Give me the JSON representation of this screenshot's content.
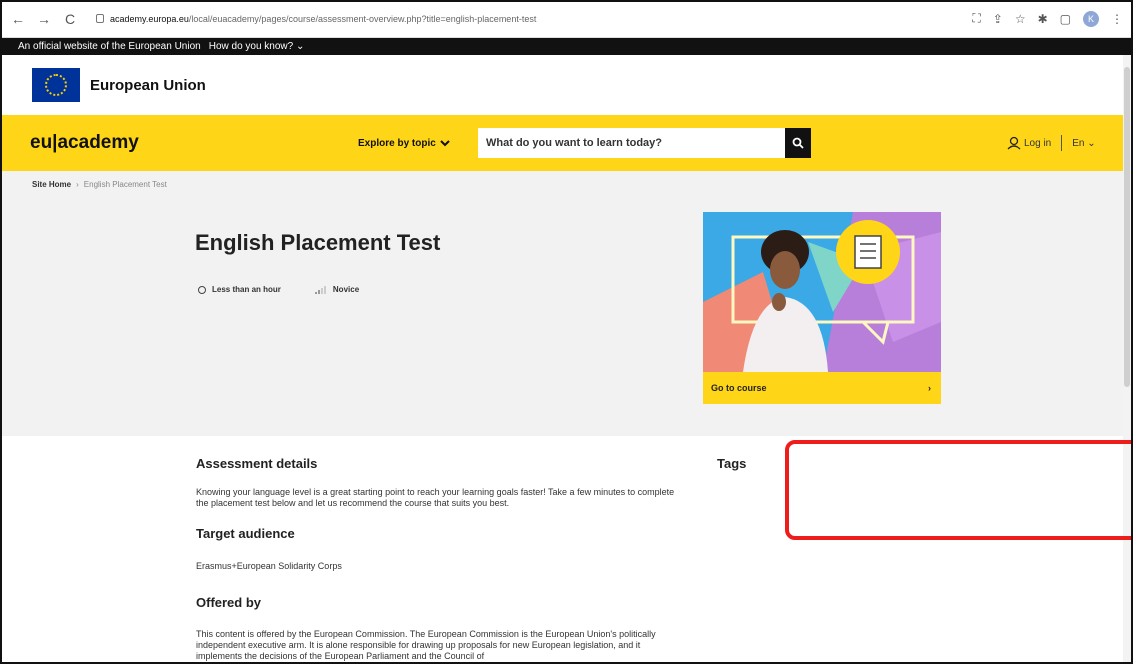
{
  "browser": {
    "url_domain": "academy.europa.eu",
    "url_path": "/local/euacademy/pages/course/assessment-overview.php?title=english-placement-test",
    "profile_initial": "K"
  },
  "official_banner": {
    "text": "An official website of the European Union",
    "link": "How do you know?"
  },
  "eu_header": {
    "name": "European Union"
  },
  "nav": {
    "logo": "eu|academy",
    "explore": "Explore by topic",
    "search_placeholder": "What do you want to learn today?",
    "login": "Log in",
    "language": "En"
  },
  "breadcrumb": {
    "home": "Site Home",
    "current": "English Placement Test"
  },
  "hero": {
    "title": "English Placement Test",
    "duration": "Less than an hour",
    "level": "Novice"
  },
  "card": {
    "cta": "Go to course"
  },
  "content": {
    "assessment_heading": "Assessment details",
    "assessment_text": "Knowing your language level is a great starting point to reach your learning goals faster! Take a few minutes to complete the placement test below and let us recommend the course that suits you best.",
    "target_heading": "Target audience",
    "target_text": "Erasmus+European Solidarity Corps",
    "offered_heading": "Offered by",
    "offered_text": "This content is offered by the European Commission. The European Commission is the European Union's politically independent executive arm. It is alone responsible for drawing up proposals for new European legislation, and it implements the decisions of the European Parliament and the Council of",
    "tags_heading": "Tags"
  },
  "colors": {
    "brand_yellow": "#ffd617",
    "eu_blue": "#003399",
    "highlight_red": "#ef1c1c"
  }
}
